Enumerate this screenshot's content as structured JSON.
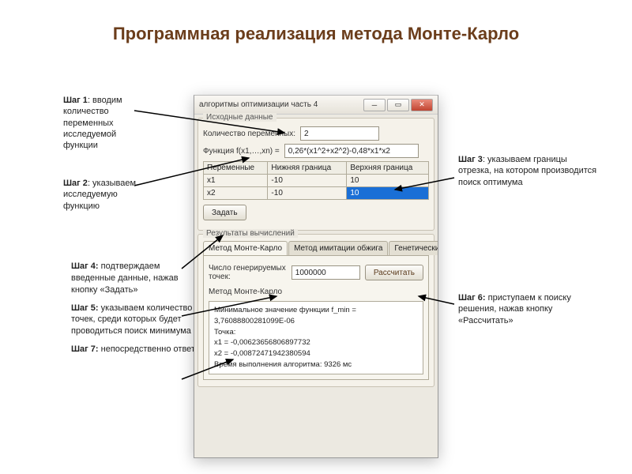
{
  "slide_title": "Программная реализация метода Монте-Карло",
  "annotations": {
    "step1": {
      "bold": "Шаг 1",
      "text": ": вводим количество переменных исследуемой функции"
    },
    "step2": {
      "bold": "Шаг 2",
      "text": ": указываем исследуемую функцию"
    },
    "step3": {
      "bold": "Шаг 3",
      "text": ": указываем границы отрезка, на котором производится поиск оптимума"
    },
    "step4": {
      "bold": "Шаг 4:",
      "text": " подтверждаем введенные данные, нажав кнопку «Задать»"
    },
    "step5": {
      "bold": "Шаг 5:",
      "text": " указываем количество точек, среди которых будет проводиться поиск минимума"
    },
    "step6": {
      "bold": "Шаг 6:",
      "text": " приступаем к поиску решения, нажав кнопку «Рассчитать»"
    },
    "step7": {
      "bold": "Шаг 7:",
      "text": " непосредственно ответ"
    }
  },
  "app": {
    "title": "алгоритмы оптимизации часть 4",
    "group_input": {
      "title": "Исходные данные",
      "vars_label": "Количество переменных:",
      "vars_value": "2",
      "func_label": "Функция f(x1,…,xn) =",
      "func_value": "0,26*(x1^2+x2^2)-0,48*x1*x2",
      "grid_headers": [
        "Переменные",
        "Нижняя граница",
        "Верхняя граница"
      ],
      "rows": [
        {
          "name": "x1",
          "low": "-10",
          "high": "10"
        },
        {
          "name": "x2",
          "low": "-10",
          "high": "10"
        }
      ],
      "set_button": "Задать"
    },
    "group_results": {
      "title": "Результаты вычислений",
      "tabs": [
        "Метод Монте-Карло",
        "Метод имитации обжига",
        "Генетический алгоритм"
      ],
      "points_label": "Число генерируемых точек:",
      "points_value": "1000000",
      "calc_button": "Рассчитать",
      "method_label": "Метод Монте-Карло",
      "result_text": "Минимальное значение функции f_min = 3,76088800281099E-06\nТочка:\nx1 = -0,00623656806897732\nx2 = -0,00872471942380594\nВремя выполнения алгоритма: 9326 мс"
    }
  }
}
